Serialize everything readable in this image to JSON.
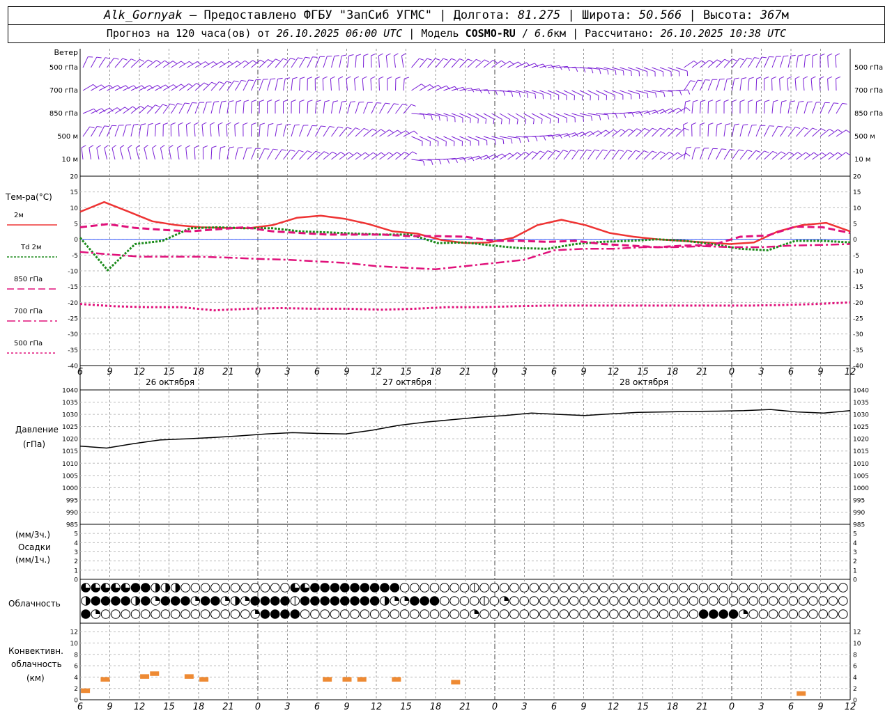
{
  "header": {
    "station": "Alk_Gornyak",
    "provided_by": " – Предоставлено ФГБУ \"ЗапСиб УГМС\" | Долгота: ",
    "longitude": "81.275",
    "lat_label": " | Широта: ",
    "latitude": "50.566",
    "alt_label": " | Высота: ",
    "altitude": "367",
    "alt_unit": "м",
    "forecast_prefix": "Прогноз на 120 часа(ов) от ",
    "forecast_start": "26.10.2025 06:00 UTC",
    "model_label": " | Модель ",
    "model_name": "COSMO-RU",
    "model_sep": " / ",
    "model_res": "6.6",
    "model_res_unit": "км",
    "calc_label": " | Рассчитано: ",
    "calc_time": "26.10.2025 10:38 UTC"
  },
  "wind_panel": {
    "title": "Ветер",
    "levels": [
      "500 гПа",
      "700 гПа",
      "850 гПа",
      "500 м",
      "10 м"
    ],
    "color": "#7a1fd6"
  },
  "temp_panel": {
    "title": "Тем-ра(°C)",
    "legend": [
      {
        "label": "2м",
        "color": "#ee3333",
        "style": "solid"
      },
      {
        "label": "Td  2м",
        "color": "#1a8a1a",
        "style": "dot"
      },
      {
        "label": "850 гПа",
        "color": "#e0107a",
        "style": "dash"
      },
      {
        "label": "700 гПа",
        "color": "#e0107a",
        "style": "dashdot"
      },
      {
        "label": "500 гПа",
        "color": "#e0107a",
        "style": "fine"
      }
    ],
    "y_ticks": [
      "20",
      "15",
      "10",
      "5",
      "0",
      "-5",
      "-10",
      "-15",
      "-20",
      "-25",
      "-30",
      "-35",
      "-40"
    ]
  },
  "x_axis": {
    "hour_labels": [
      "6",
      "9",
      "12",
      "15",
      "18",
      "21",
      "0",
      "3",
      "6",
      "9",
      "12",
      "15",
      "18",
      "21",
      "0",
      "3",
      "6",
      "9",
      "12",
      "15",
      "18",
      "21",
      "0",
      "3",
      "6",
      "9",
      "12"
    ],
    "dates": [
      "26 октября",
      "27 октября",
      "28 октября"
    ]
  },
  "pressure_panel": {
    "title": "Давление",
    "unit": "(гПа)",
    "y_ticks": [
      "1040",
      "1035",
      "1030",
      "1025",
      "1020",
      "1015",
      "1010",
      "1005",
      "1000",
      "995",
      "990",
      "985"
    ]
  },
  "precip_panel": {
    "unit_top": "(мм/3ч.)",
    "title": "Осадки",
    "unit_bottom": "(мм/1ч.)",
    "y_ticks": [
      "5",
      "4",
      "3",
      "2",
      "1",
      "0"
    ]
  },
  "cloud_panel": {
    "title": "Облачность"
  },
  "convective_panel": {
    "title_1": "Конвективн.",
    "title_2": "облачность",
    "unit": "(км)",
    "y_ticks": [
      "12",
      "10",
      "8",
      "6",
      "4",
      "2",
      "0"
    ],
    "color": "#ee8a33"
  },
  "chart_data": {
    "type": "line",
    "time_hours": [
      0,
      3,
      6,
      9,
      12,
      15,
      18,
      21,
      24,
      27,
      30,
      33,
      36,
      39,
      42,
      45,
      48,
      51,
      54,
      57,
      60,
      63,
      66,
      69,
      72,
      75,
      78
    ],
    "series": [
      {
        "name": "2м",
        "values": [
          8.7,
          11.8,
          8.8,
          5.7,
          4.5,
          3.8,
          3.6,
          3.5,
          4.5,
          6.8,
          7.5,
          6.5,
          4.8,
          2.5,
          1.8,
          -0.2,
          -1.2,
          -1.0,
          0.5,
          4.5,
          6.2,
          4.5,
          2.0,
          0.8,
          0.0,
          -0.5,
          -1.0,
          -1.5,
          -1.0,
          2.5,
          4.5,
          5.2,
          2.5
        ]
      },
      {
        "name": "Td  2м",
        "values": [
          0.5,
          -9.8,
          -1.5,
          -0.5,
          3.5,
          3.8,
          3.5,
          3.5,
          2.5,
          2.2,
          1.8,
          1.5,
          1.5,
          -1.2,
          -1.0,
          -2.0,
          -2.8,
          -3.0,
          -1.5,
          -0.8,
          -0.5,
          0.0,
          -0.5,
          -1.5,
          -3.0,
          -3.5,
          -0.5,
          -0.5,
          -1.0
        ]
      },
      {
        "name": "850 гПа",
        "values": [
          3.8,
          4.8,
          3.6,
          3.0,
          2.5,
          3.2,
          3.8,
          2.5,
          2.0,
          1.5,
          1.5,
          1.5,
          1.0,
          1.0,
          0.8,
          -0.5,
          -0.5,
          -0.8,
          -0.5,
          -1.5,
          -2.0,
          -2.5,
          -2.0,
          -1.8,
          0.8,
          1.2,
          4.0,
          3.8,
          2.0
        ]
      },
      {
        "name": "700 гПа",
        "values": [
          -4.0,
          -4.8,
          -5.5,
          -5.5,
          -5.5,
          -5.8,
          -6.2,
          -6.5,
          -7.0,
          -7.5,
          -8.5,
          -9.0,
          -9.5,
          -8.5,
          -7.5,
          -6.5,
          -3.5,
          -3.0,
          -3.0,
          -2.5,
          -2.5,
          -2.2,
          -2.5,
          -2.5,
          -2.0,
          -1.8,
          -1.5
        ]
      },
      {
        "name": "500 гПа",
        "values": [
          -20.5,
          -21.2,
          -21.5,
          -21.5,
          -22.5,
          -22.0,
          -21.8,
          -22.0,
          -22.0,
          -22.3,
          -22.0,
          -21.5,
          -21.5,
          -21.2,
          -21.0,
          -21.0,
          -21.0,
          -21.0,
          -21.0,
          -21.0,
          -21.0,
          -20.8,
          -20.5,
          -20.0
        ]
      },
      {
        "name": "Давление",
        "values": [
          1017,
          1016.2,
          1018,
          1019.5,
          1020,
          1020.5,
          1021.2,
          1022,
          1022.5,
          1022.2,
          1022,
          1023.5,
          1025.5,
          1026.8,
          1027.8,
          1028.8,
          1029.5,
          1030.5,
          1030,
          1029.5,
          1030.2,
          1030.8,
          1031,
          1031.2,
          1031.3,
          1031.5,
          1032,
          1031,
          1030.5,
          1031.5
        ]
      }
    ],
    "convective_blocks": [
      {
        "x": 0.5,
        "h": 2
      },
      {
        "x": 2.5,
        "h": 4
      },
      {
        "x": 6.5,
        "h": 4.5
      },
      {
        "x": 7.5,
        "h": 5
      },
      {
        "x": 11,
        "h": 4.5
      },
      {
        "x": 12.5,
        "h": 4
      },
      {
        "x": 25,
        "h": 4
      },
      {
        "x": 27,
        "h": 4
      },
      {
        "x": 28.5,
        "h": 4
      },
      {
        "x": 32,
        "h": 4
      },
      {
        "x": 38,
        "h": 3.5
      },
      {
        "x": 73,
        "h": 1.5
      }
    ],
    "cloud_rows": [
      "pppppffhhhnnnnnnnnnnnppfffffffffnnnnnnndnnnnnnnnnnnnnnnnnnnnnnnnnnnnnnnnnnnnnnnn",
      "hffffhfqfffqffqhqffffdffffffffhqqfffnnnndnqnnnnnnnnnnnnnnnnnnnnnnnnnnnnnnnnnnnnnn",
      "fqnnnnnnnnnnnnnnnqffffnnnnnnnnnnnnnnnnnqnnnnnnnnnnnnnnnnnnnnnnffffqnnnnnnnnnnnnnn"
    ]
  }
}
